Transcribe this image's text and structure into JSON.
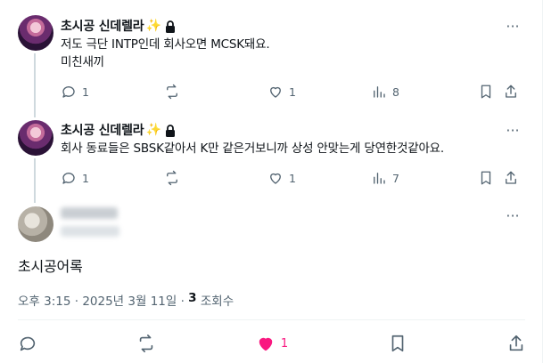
{
  "replies": [
    {
      "display_name": "초시공 신데렐라",
      "sparkle": "✨",
      "text": "저도 극단 INTP인데 회사오면 MCSK돼요.\n미친새끼",
      "stats": {
        "replies": "1",
        "reposts": "",
        "likes": "1",
        "views": "8"
      }
    },
    {
      "display_name": "초시공 신데렐라",
      "sparkle": "✨",
      "text": "회사 동료들은 SBSK같아서 K만 같은거보니까 상성 안맞는게 당연한것같아요.",
      "stats": {
        "replies": "1",
        "reposts": "",
        "likes": "1",
        "views": "7"
      }
    }
  ],
  "main_post": {
    "text": "초시공어록",
    "time": "오후 3:15 · 2025년 3월 11일 · ",
    "views_count": "3",
    "views_label": " 조회수",
    "likes": "1"
  },
  "colors": {
    "like_active": "#f91880",
    "icon_gray": "#536471",
    "thread_line": "#cfd9de"
  }
}
